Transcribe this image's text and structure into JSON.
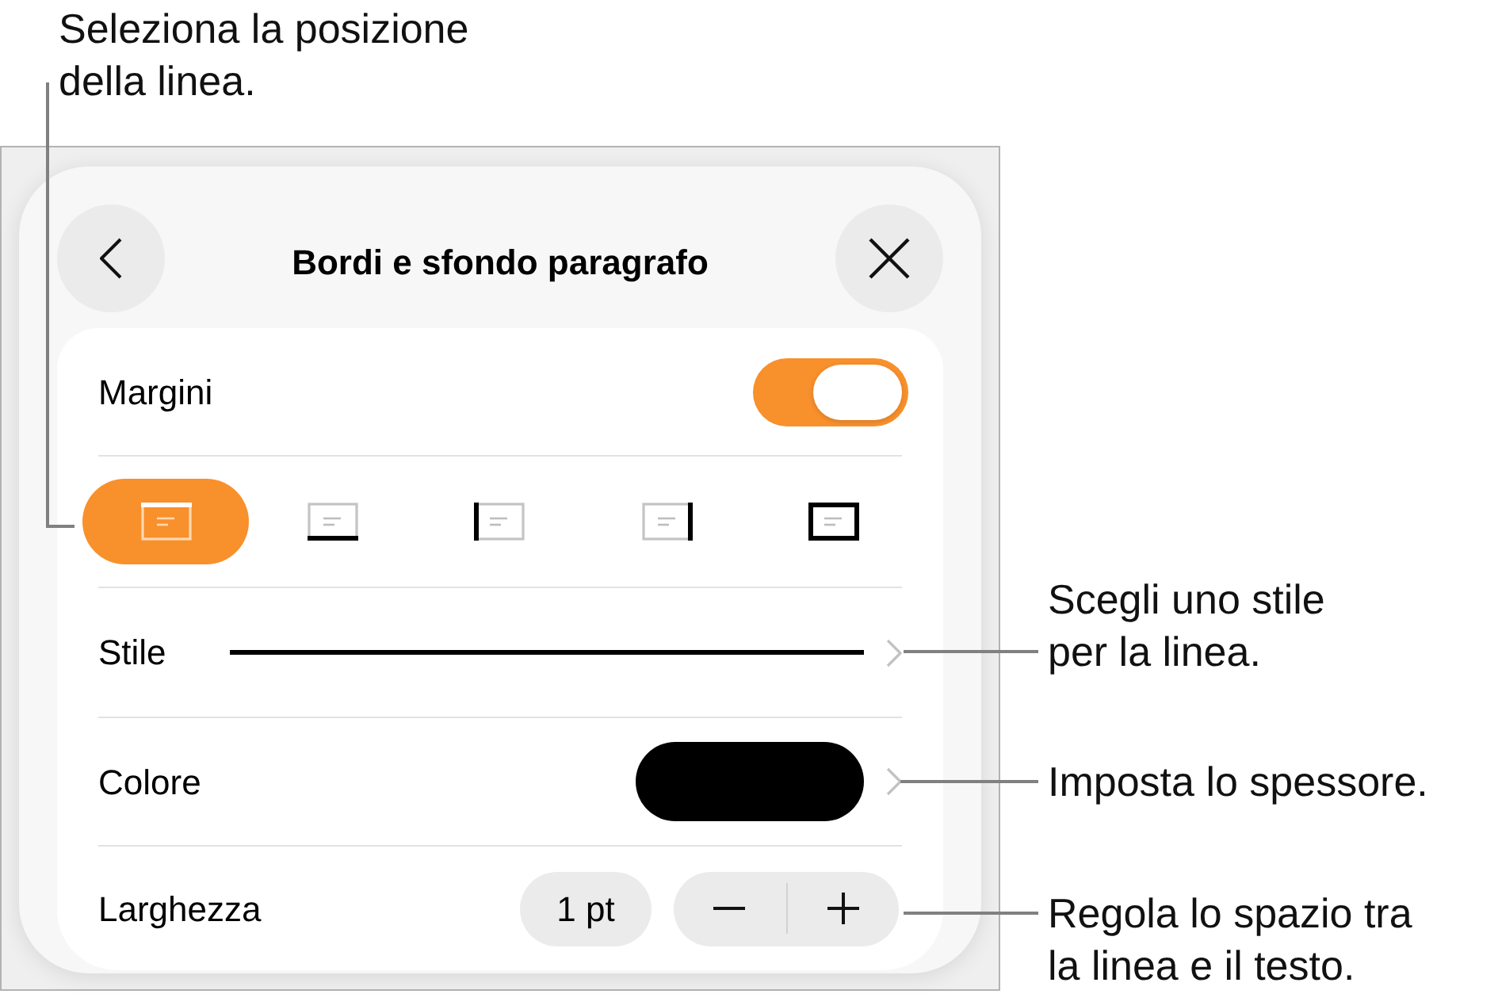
{
  "callouts": [
    {
      "text": "Seleziona la posizione della linea."
    },
    {
      "text": "Scegli uno stile per la linea."
    },
    {
      "text": "Imposta lo spessore."
    },
    {
      "text": "Regola lo spazio tra la linea e il testo."
    }
  ],
  "panel": {
    "title": "Bordi e sfondo paragrafo",
    "rows": [
      {
        "kind": "toggle",
        "label": "Margini",
        "on": true
      },
      {
        "kind": "positions",
        "options": [
          {
            "kind": "top",
            "selected": true
          },
          {
            "kind": "bottom",
            "selected": false
          },
          {
            "kind": "left",
            "selected": false
          },
          {
            "kind": "right",
            "selected": false
          },
          {
            "kind": "all",
            "selected": false
          }
        ]
      },
      {
        "kind": "style",
        "label": "Stile"
      },
      {
        "kind": "color",
        "label": "Colore",
        "color": "#000000"
      },
      {
        "kind": "width",
        "label": "Larghezza",
        "value": "1 pt"
      }
    ]
  }
}
